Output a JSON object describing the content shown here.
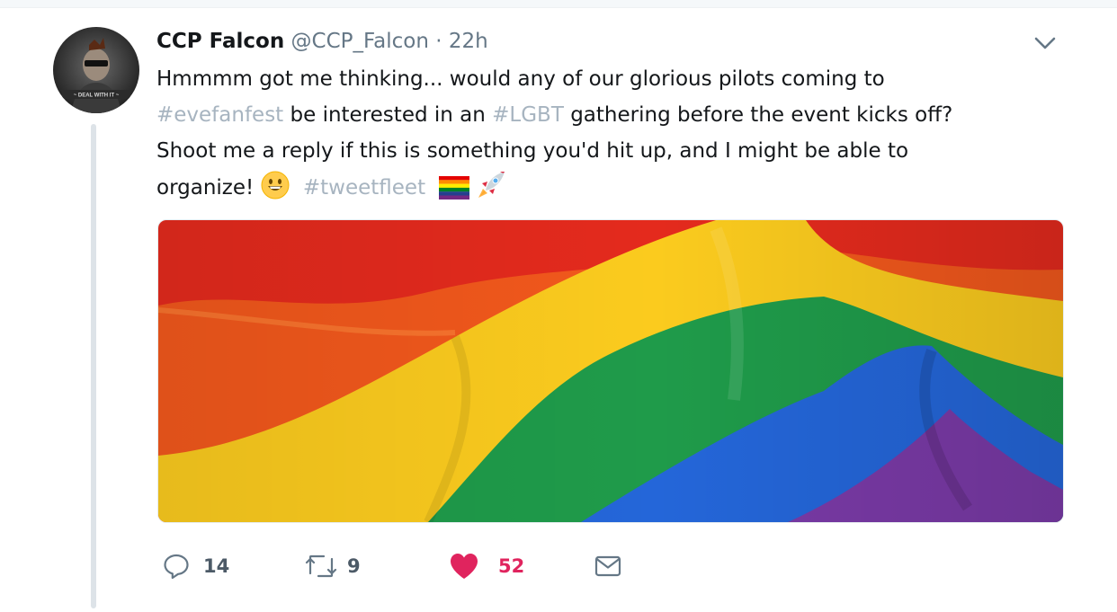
{
  "tweet": {
    "author_name": "CCP Falcon",
    "author_handle": "@CCP_Falcon",
    "separator": "·",
    "timestamp": "22h",
    "avatar_caption": "~ DEAL WITH IT ~",
    "text": {
      "line1": "Hmmmm got me thinking... would any of our glorious pilots coming to",
      "hashtag_evefanfest": "#evefanfest",
      "mid1": " be interested in an ",
      "hashtag_lgbt": "#LGBT",
      "mid2": " gathering before the event kicks off?",
      "line3": "Shoot me a reply if this is something you'd hit up, and I might be able to",
      "line4_start": "organize! ",
      "hashtag_tweetfleet": "#tweetfleet"
    },
    "emojis": [
      "grinning-face-icon",
      "rainbow-flag-icon",
      "rocket-icon"
    ],
    "media_alt": "Rainbow pride flag",
    "stats": {
      "replies": "14",
      "retweets": "9",
      "likes": "52"
    },
    "liked": true
  },
  "colors": {
    "text": "#14171a",
    "secondary": "#657786",
    "hashtag": "#a7b4c0",
    "like": "#e0245e",
    "thread_line": "#dde3e8"
  }
}
